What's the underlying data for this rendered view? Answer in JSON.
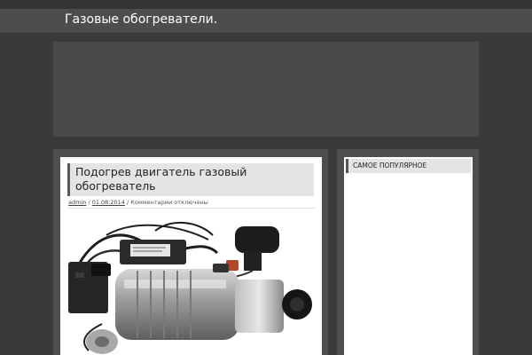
{
  "site": {
    "title": "Газовые обогреватели."
  },
  "post": {
    "title": "Подогрев двигатель газовый обогреватель",
    "meta": {
      "author": "admin",
      "separator1": " / ",
      "date": "01.08.2014",
      "separator2": " / ",
      "comments": "Комментарии отключены"
    },
    "image_alt": "gas-engine-preheater-photo"
  },
  "sidebar": {
    "widget_title": "САМОЕ ПОПУЛЯРНОЕ"
  },
  "colors": {
    "background": "#3a3a3a",
    "header_bar": "#4d4d4d",
    "panel": "#4e4e4e",
    "card": "#ffffff",
    "title_box": "#e4e4e4"
  }
}
